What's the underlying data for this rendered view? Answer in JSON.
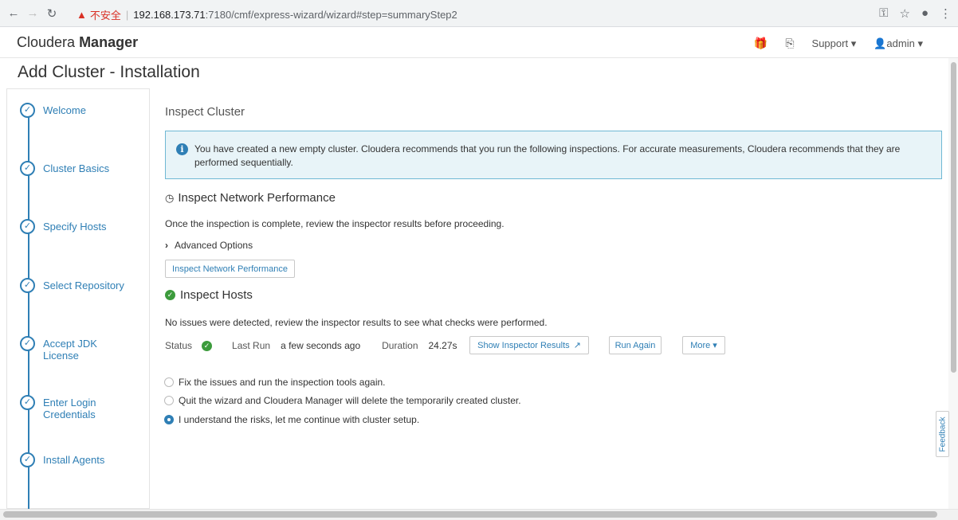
{
  "browser": {
    "security_label": "不安全",
    "url_host": "192.168.173.71",
    "url_path": ":7180/cmf/express-wizard/wizard#step=summaryStep2"
  },
  "header": {
    "brand_light": "Cloudera",
    "brand_bold": "Manager",
    "support_label": "Support",
    "user_label": "admin"
  },
  "page_title": "Add Cluster - Installation",
  "steps": [
    {
      "label": "Welcome"
    },
    {
      "label": "Cluster Basics"
    },
    {
      "label": "Specify Hosts"
    },
    {
      "label": "Select Repository"
    },
    {
      "label": "Accept JDK License"
    },
    {
      "label": "Enter Login Credentials"
    },
    {
      "label": "Install Agents"
    }
  ],
  "main": {
    "section_title": "Inspect Cluster",
    "info_text": "You have created a new empty cluster. Cloudera recommends that you run the following inspections. For accurate measurements, Cloudera recommends that they are performed sequentially.",
    "network": {
      "title": "Inspect Network Performance",
      "description": "Once the inspection is complete, review the inspector results before proceeding.",
      "advanced_label": "Advanced Options",
      "button_label": "Inspect Network Performance"
    },
    "hosts": {
      "title": "Inspect Hosts",
      "description": "No issues were detected, review the inspector results to see what checks were performed.",
      "status_label": "Status",
      "last_run_label": "Last Run",
      "last_run_value": "a few seconds ago",
      "duration_label": "Duration",
      "duration_value": "24.27s",
      "show_results_label": "Show Inspector Results",
      "run_again_label": "Run Again",
      "more_label": "More"
    },
    "options": [
      {
        "label": "Fix the issues and run the inspection tools again.",
        "selected": false
      },
      {
        "label": "Quit the wizard and Cloudera Manager will delete the temporarily created cluster.",
        "selected": false
      },
      {
        "label": "I understand the risks, let me continue with cluster setup.",
        "selected": true
      }
    ]
  },
  "feedback_label": "Feedback",
  "colors": {
    "accent": "#2f7fb5",
    "success": "#3c9b3c",
    "info_bg": "#e8f4f8"
  }
}
